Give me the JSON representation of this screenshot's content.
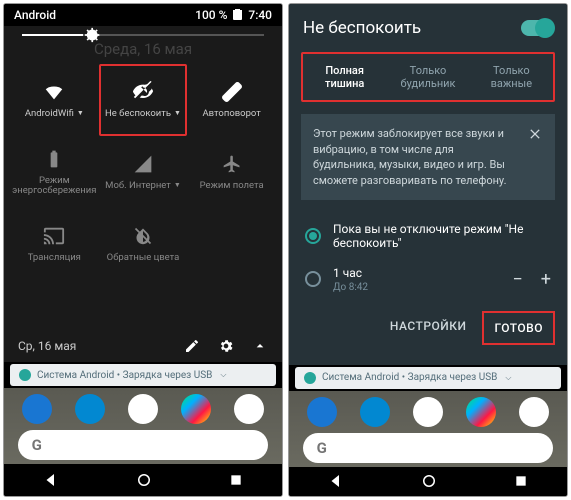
{
  "left": {
    "status": {
      "label": "Android",
      "battery": "100 %",
      "time": "7:40"
    },
    "date_bg": "Среда, 16 мая",
    "tiles": [
      {
        "label": "AndroidWifi",
        "icon": "wifi"
      },
      {
        "label": "Не беспокоить",
        "icon": "dnd",
        "highlight": true
      },
      {
        "label": "Автоповорот",
        "icon": "rotate"
      },
      {
        "label": "Режим энергосбережения",
        "icon": "battery"
      },
      {
        "label": "Моб. Интернет",
        "icon": "data"
      },
      {
        "label": "Режим полета",
        "icon": "airplane"
      },
      {
        "label": "Трансляция",
        "icon": "cast"
      },
      {
        "label": "Обратные цвета",
        "icon": "invert"
      }
    ],
    "footer_date": "Ср, 16 мая",
    "notif": "Система Android • Зарядка через USB"
  },
  "right": {
    "title": "Не беспокоить",
    "tabs": [
      {
        "l1": "Полная",
        "l2": "тишина",
        "active": true
      },
      {
        "l1": "Только",
        "l2": "будильник",
        "active": false
      },
      {
        "l1": "Только",
        "l2": "важные",
        "active": false
      }
    ],
    "info": "Этот режим заблокирует все звуки и вибрацию, в том числе для будильника, музыки, видео и игр. Вы сможете разговаривать по телефону.",
    "opt1": "Пока вы не отключите режим \"Не беспокоить\"",
    "opt2": {
      "label": "1 час",
      "sub": "До 8:42"
    },
    "settings": "НАСТРОЙКИ",
    "done": "ГОТОВО",
    "notif": "Система Android • Зарядка через USB"
  }
}
